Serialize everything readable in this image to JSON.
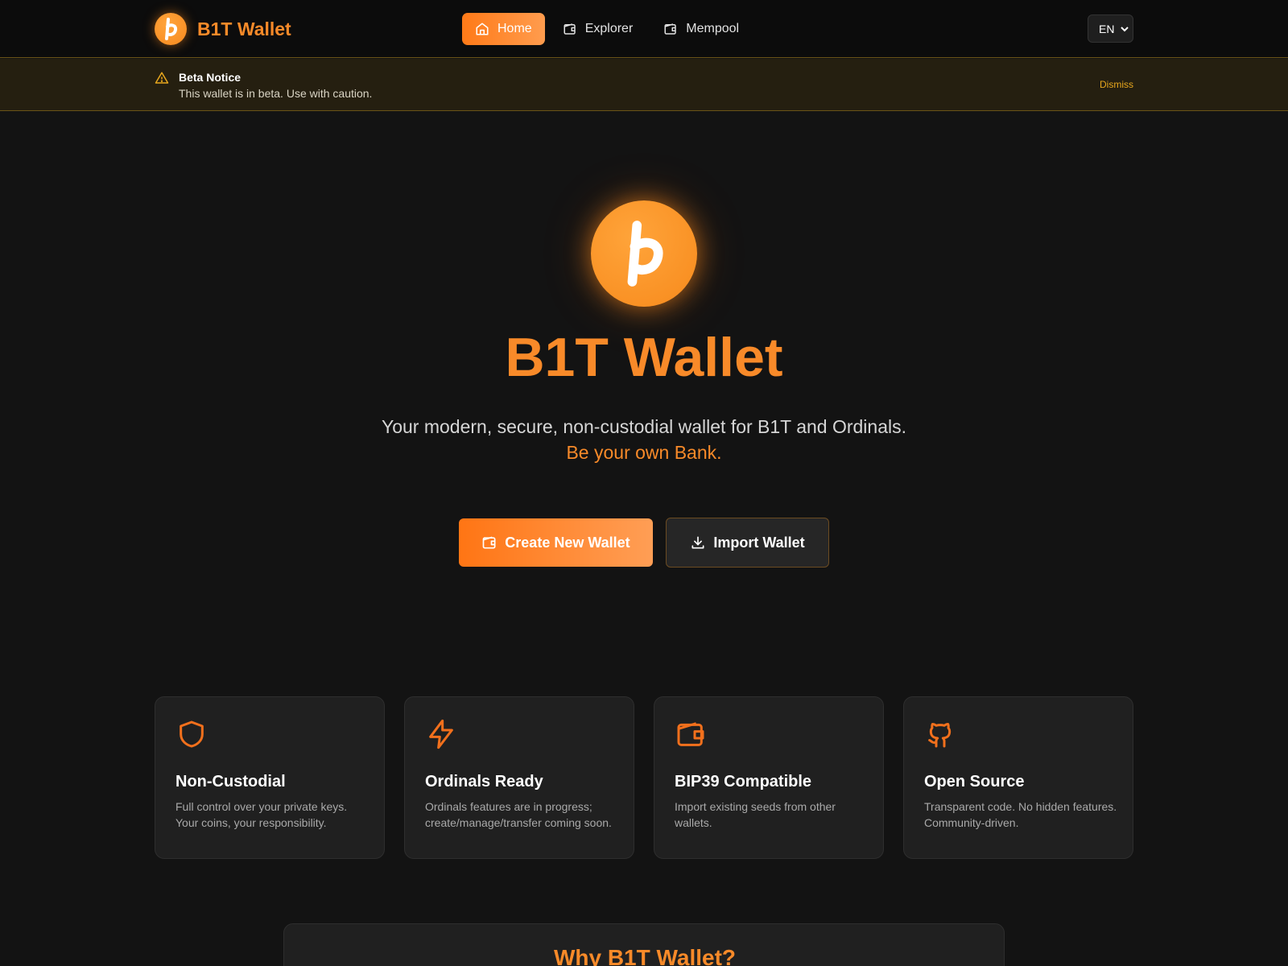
{
  "header": {
    "brand_name": "B1T Wallet",
    "nav": [
      {
        "label": "Home",
        "icon": "home-icon",
        "active": true
      },
      {
        "label": "Explorer",
        "icon": "wallet-icon",
        "active": false
      },
      {
        "label": "Mempool",
        "icon": "wallet-icon",
        "active": false
      }
    ],
    "language": "EN"
  },
  "notice": {
    "title": "Beta Notice",
    "text": "This wallet is in beta. Use with caution.",
    "dismiss_label": "Dismiss"
  },
  "hero": {
    "title": "B1T Wallet",
    "subtitle": "Your modern, secure, non-custodial wallet for B1T and Ordinals.",
    "tagline": "Be your own Bank.",
    "create_label": "Create New Wallet",
    "import_label": "Import Wallet"
  },
  "features": [
    {
      "icon": "shield-icon",
      "title": "Non-Custodial",
      "desc": "Full control over your private keys. Your coins, your responsibility."
    },
    {
      "icon": "lightning-icon",
      "title": "Ordinals Ready",
      "desc": "Ordinals features are in progress; create/manage/transfer coming soon."
    },
    {
      "icon": "wallet-icon",
      "title": "BIP39 Compatible",
      "desc": "Import existing seeds from other wallets."
    },
    {
      "icon": "github-icon",
      "title": "Open Source",
      "desc": "Transparent code. No hidden features. Community-driven."
    }
  ],
  "why": {
    "title": "Why B1T Wallet?"
  },
  "colors": {
    "accent": "#f88a29",
    "warning": "#e8a71d",
    "background": "#131313",
    "card": "#202020"
  }
}
